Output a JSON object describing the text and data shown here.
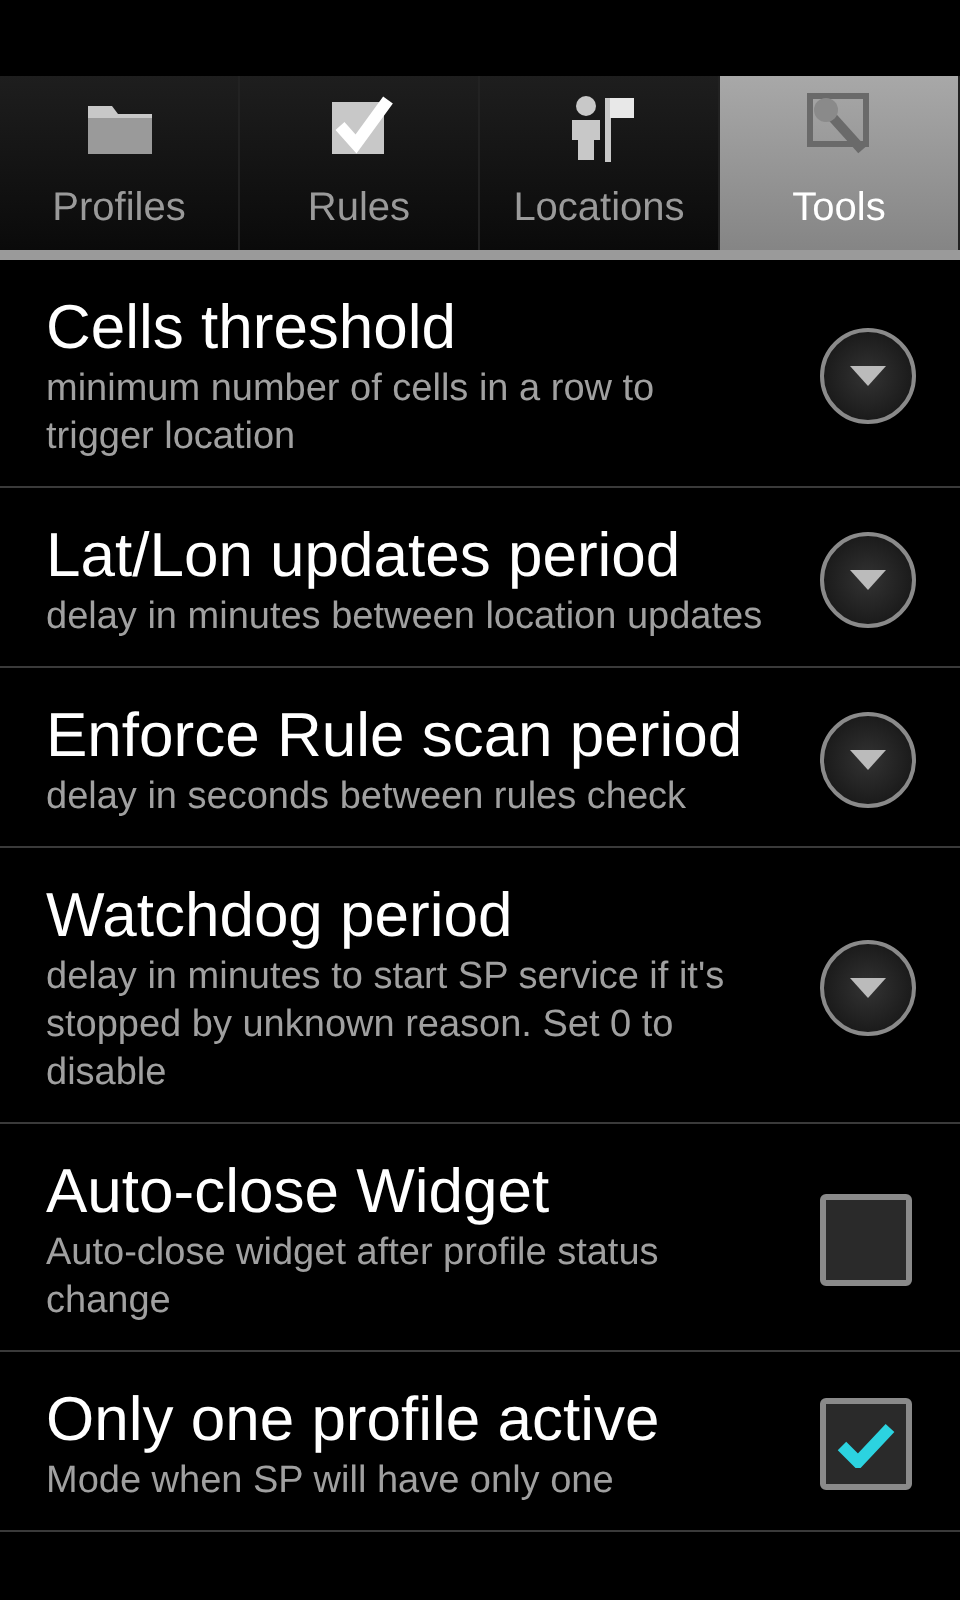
{
  "tabs": [
    {
      "label": "Profiles",
      "selected": false
    },
    {
      "label": "Rules",
      "selected": false
    },
    {
      "label": "Locations",
      "selected": false
    },
    {
      "label": "Tools",
      "selected": true
    }
  ],
  "settings": [
    {
      "kind": "dropdown",
      "title": "Cells threshold",
      "summary": "minimum number of cells in a row to trigger location"
    },
    {
      "kind": "dropdown",
      "title": "Lat/Lon updates period",
      "summary": "delay in minutes between location updates"
    },
    {
      "kind": "dropdown",
      "title": "Enforce Rule scan period",
      "summary": "delay in seconds between rules check"
    },
    {
      "kind": "dropdown",
      "title": "Watchdog period",
      "summary": "delay in minutes to start SP service if it's stopped by unknown reason. Set 0 to disable"
    },
    {
      "kind": "checkbox",
      "title": "Auto-close Widget",
      "summary": "Auto-close widget after profile status change",
      "checked": false
    },
    {
      "kind": "checkbox",
      "title": "Only one profile active",
      "summary": "Mode when SP will have only one",
      "checked": true
    }
  ]
}
